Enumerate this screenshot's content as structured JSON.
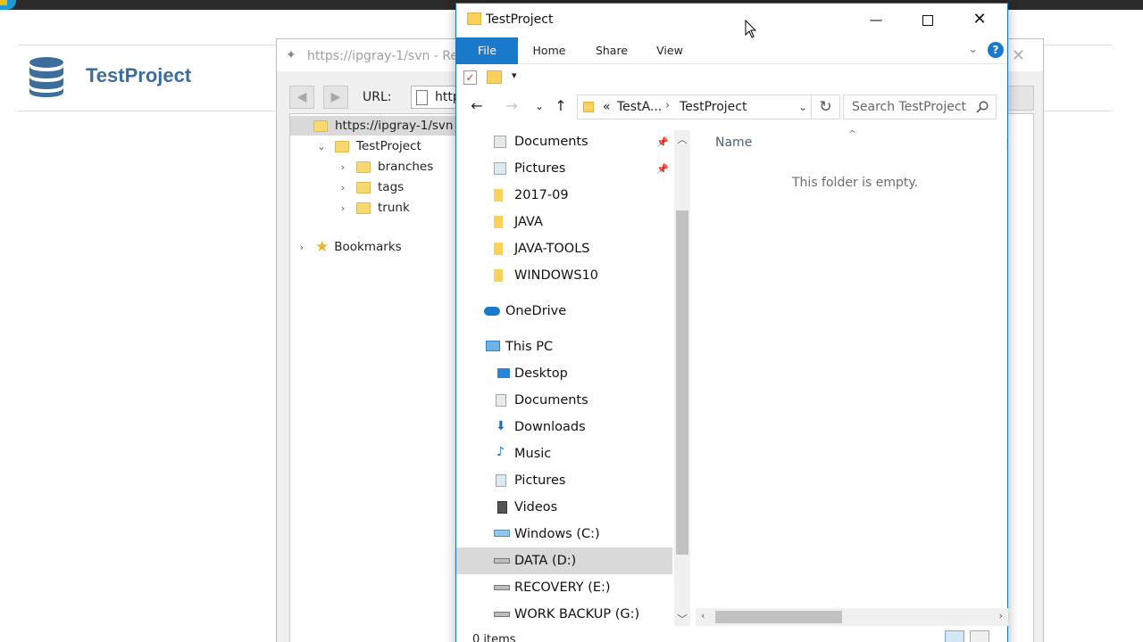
{
  "background_page": {
    "title": "TestProject"
  },
  "repo_browser": {
    "title": "https://ipgray-1/svn - Repo",
    "url_label": "URL:",
    "url_value": "https:",
    "tree": [
      {
        "label": "https://ipgray-1/svn"
      },
      {
        "label": "TestProject"
      },
      {
        "label": "branches"
      },
      {
        "label": "tags"
      },
      {
        "label": "trunk"
      }
    ],
    "bookmarks": "Bookmarks"
  },
  "explorer": {
    "title": "TestProject",
    "tabs": {
      "file": "File",
      "home": "Home",
      "share": "Share",
      "view": "View"
    },
    "help": "?",
    "address": {
      "overflow": "«",
      "crumb1": "TestA...",
      "crumb2": "TestProject"
    },
    "search_placeholder": "Search TestProject",
    "nav": {
      "quick_access": [
        {
          "label": "Documents"
        },
        {
          "label": "Pictures"
        },
        {
          "label": "2017-09"
        },
        {
          "label": "JAVA"
        },
        {
          "label": "JAVA-TOOLS"
        },
        {
          "label": "WINDOWS10"
        }
      ],
      "onedrive": "OneDrive",
      "this_pc": "This PC",
      "pc_items": [
        {
          "label": "Desktop"
        },
        {
          "label": "Documents"
        },
        {
          "label": "Downloads"
        },
        {
          "label": "Music"
        },
        {
          "label": "Pictures"
        },
        {
          "label": "Videos"
        },
        {
          "label": "Windows (C:)"
        },
        {
          "label": "DATA (D:)"
        },
        {
          "label": "RECOVERY (E:)"
        },
        {
          "label": "WORK BACKUP (G:)"
        }
      ]
    },
    "content": {
      "column_name": "Name",
      "empty_message": "This folder is empty."
    },
    "status": "0 items"
  },
  "colors": {
    "accent": "#1979ca",
    "title_blue": "#3c6d9b"
  }
}
